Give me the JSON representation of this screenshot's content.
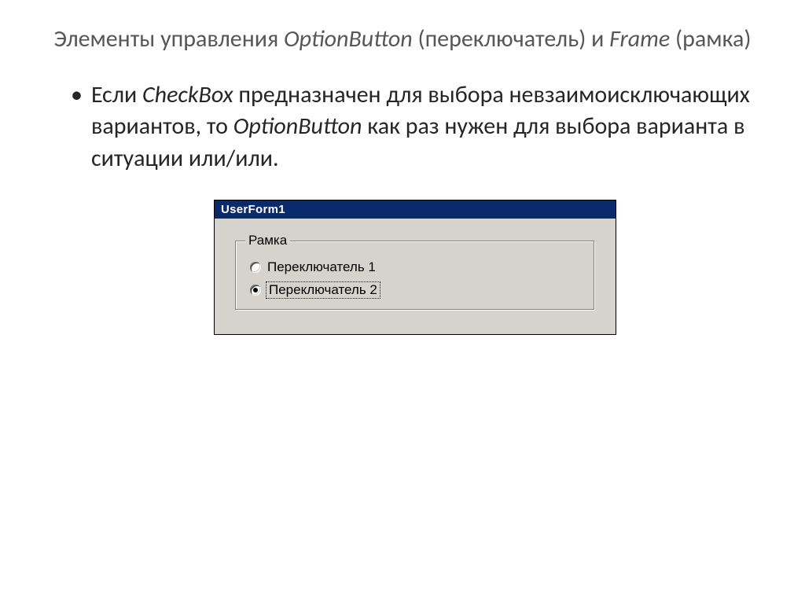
{
  "title": {
    "prefix": "Элементы управления ",
    "em1": "OptionButton",
    "mid": " (переключатель) и ",
    "em2": "Frame",
    "suffix": " (рамка)"
  },
  "bullet": {
    "t1": "Если ",
    "em1": "CheckBox",
    "t2": " предназначен для выбора невзаимоисключающих вариантов, то ",
    "em2": "OptionButton",
    "t3": " как раз нужен для выбора варианта в ситуации или/или."
  },
  "form": {
    "title": "UserForm1",
    "frame_caption": "Рамка",
    "options": [
      {
        "label": "Переключатель 1",
        "checked": false,
        "focused": false
      },
      {
        "label": "Переключатель 2",
        "checked": true,
        "focused": true
      }
    ]
  }
}
